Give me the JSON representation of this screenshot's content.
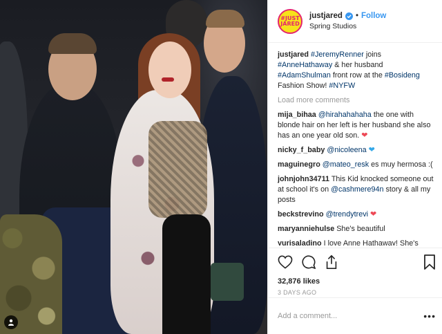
{
  "post": {
    "username": "justjared",
    "follow_label": "Follow",
    "separator": "•",
    "location": "Spring Studios",
    "avatar_text": "#JUST JARED",
    "caption": {
      "user": "justjared",
      "parts": [
        {
          "type": "tag",
          "text": "#JeremyRenner"
        },
        {
          "type": "text",
          "text": " joins "
        },
        {
          "type": "tag",
          "text": "#AnneHathaway"
        },
        {
          "type": "text",
          "text": " & her husband "
        },
        {
          "type": "tag",
          "text": "#AdamShulman"
        },
        {
          "type": "text",
          "text": " front row at the "
        },
        {
          "type": "tag",
          "text": "#Bosideng"
        },
        {
          "type": "text",
          "text": " Fashion Show! "
        },
        {
          "type": "tag",
          "text": "#NYFW"
        }
      ]
    },
    "load_more_label": "Load more comments",
    "comments": [
      {
        "user": "mija_bihaa",
        "parts": [
          {
            "type": "tag",
            "text": "@hirahahahaha"
          },
          {
            "type": "text",
            "text": " the one with blonde hair on her left is her husband she also has an one year old son. "
          },
          {
            "type": "emoji",
            "text": "❤",
            "color": "red"
          }
        ]
      },
      {
        "user": "nicky_f_baby",
        "parts": [
          {
            "type": "tag",
            "text": "@nicoleena"
          },
          {
            "type": "text",
            "text": " "
          },
          {
            "type": "emoji",
            "text": "❤",
            "color": "blue"
          }
        ]
      },
      {
        "user": "maguinegro",
        "parts": [
          {
            "type": "tag",
            "text": "@mateo_resk"
          },
          {
            "type": "text",
            "text": " es muy hermosa :("
          }
        ]
      },
      {
        "user": "johnjohn34711",
        "parts": [
          {
            "type": "text",
            "text": "This Kid knocked someone out at school it's on "
          },
          {
            "type": "tag",
            "text": "@cashmere94n"
          },
          {
            "type": "text",
            "text": " story & all my posts"
          }
        ]
      },
      {
        "user": "beckstrevino",
        "parts": [
          {
            "type": "tag",
            "text": "@trendytrevi"
          },
          {
            "type": "text",
            "text": " "
          },
          {
            "type": "emoji",
            "text": "❤",
            "color": "red"
          }
        ]
      },
      {
        "user": "maryanniehulse",
        "parts": [
          {
            "type": "text",
            "text": "She's beautiful"
          }
        ]
      },
      {
        "user": "yurisaladino",
        "parts": [
          {
            "type": "text",
            "text": "I love Anne Hathaway! She's"
          }
        ]
      }
    ],
    "likes": "32,876 likes",
    "date": "3 DAYS AGO",
    "add_comment_placeholder": "Add a comment...",
    "more_label": "•••"
  },
  "colors": {
    "link": "#003569",
    "follow": "#3897f0",
    "muted": "#999999",
    "heart_red": "#ed4956",
    "heart_blue": "#34a8e8",
    "avatar_bg": "#f7e21a",
    "avatar_ring": "#e4246e"
  }
}
